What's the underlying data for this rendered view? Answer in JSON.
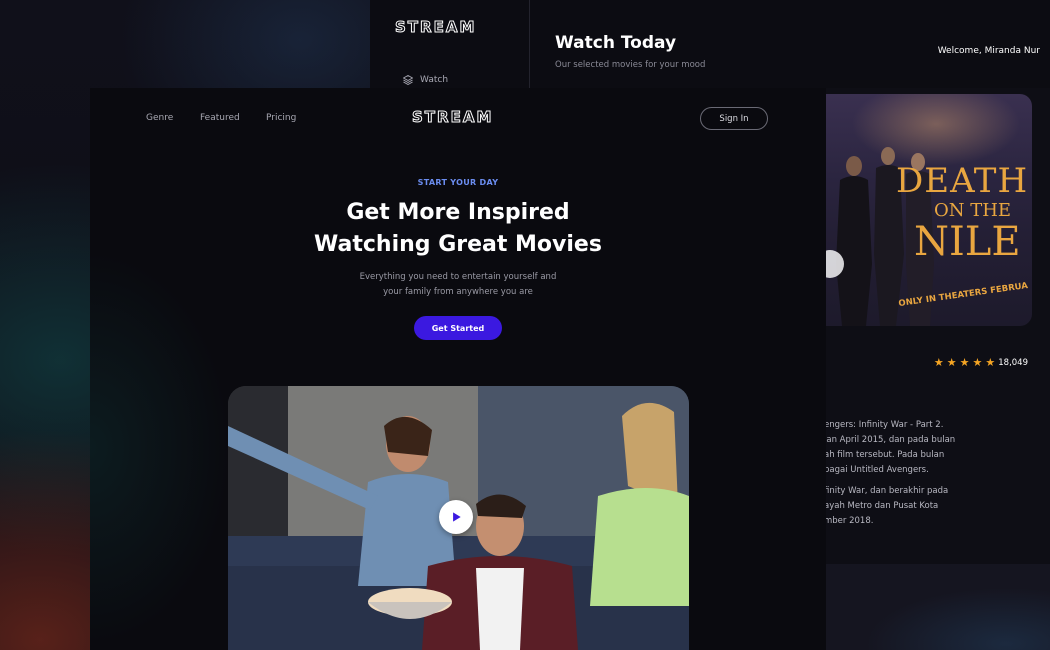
{
  "dashboard": {
    "logo": "STREAM",
    "sidebar_watch": "Watch",
    "title": "Watch Today",
    "subtitle": "Our selected movies for your mood",
    "welcome": "Welcome, Miranda Nur"
  },
  "movie_detail": {
    "poster_title_line1": "DEATH",
    "poster_title_line2": "ON THE",
    "poster_title_line3": "NILE",
    "poster_tagline": "ONLY IN THEATERS FEBRUA",
    "rating_count": "18,049",
    "stars": 5,
    "synopsis": [
      "engers: Infinity War - Part 2.",
      "lan April 2015, dan pada bulan",
      "ah film tersebut. Pada bulan",
      "bagai Untitled Avengers.",
      "finity War, dan berakhir pada",
      "ayah Metro dan Pusat Kota",
      "mber 2018."
    ]
  },
  "landing": {
    "nav": {
      "genre": "Genre",
      "featured": "Featured",
      "pricing": "Pricing"
    },
    "logo": "STREAM",
    "signin_label": "Sign In",
    "eyebrow": "START YOUR DAY",
    "headline_line1": "Get More Inspired",
    "headline_line2": "Watching Great Movies",
    "subtext_line1": "Everything you need to entertain yourself and",
    "subtext_line2": "your family from anywhere you are",
    "cta_label": "Get Started"
  },
  "colors": {
    "accent": "#3b19e0",
    "eyebrow": "#6b8df0",
    "star": "#f5a524",
    "poster_title": "#e9a640"
  },
  "icons": {
    "watch": "layers-icon",
    "play": "play-icon",
    "star": "star-icon"
  }
}
